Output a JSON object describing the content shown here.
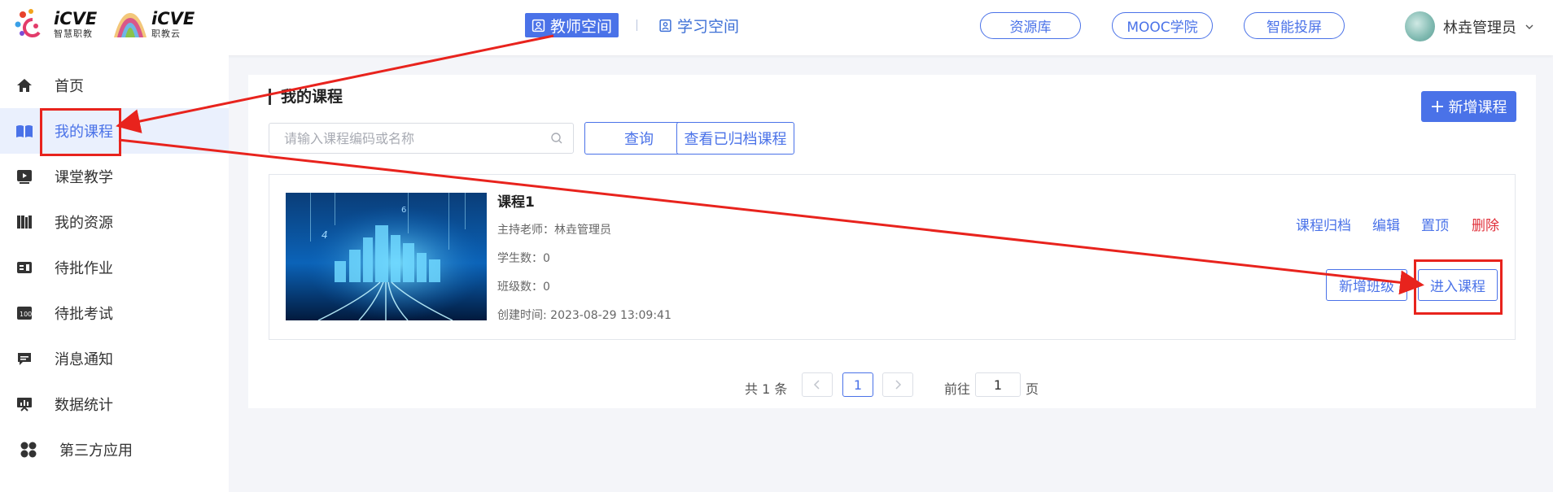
{
  "header": {
    "logos": [
      {
        "big": "iCVE",
        "small": "智慧职教"
      },
      {
        "big": "iCVE",
        "small": "职教云"
      }
    ],
    "space_tabs": [
      {
        "label": "教师空间",
        "icon": "portrait-icon",
        "active": true
      },
      {
        "label": "学习空间",
        "icon": "book-user-icon",
        "active": false
      }
    ],
    "buttons": [
      "资源库",
      "MOOC学院",
      "智能投屏"
    ],
    "user_name": "林垚管理员"
  },
  "sidebar": {
    "items": [
      {
        "label": "首页",
        "icon": "home-icon"
      },
      {
        "label": "我的课程",
        "icon": "open-book-icon",
        "active": true
      },
      {
        "label": "课堂教学",
        "icon": "play-screen-icon"
      },
      {
        "label": "我的资源",
        "icon": "books-shelf-icon"
      },
      {
        "label": "待批作业",
        "icon": "homework-icon"
      },
      {
        "label": "待批考试",
        "icon": "exam-icon"
      },
      {
        "label": "消息通知",
        "icon": "message-icon"
      },
      {
        "label": "数据统计",
        "icon": "statistics-icon"
      },
      {
        "label": "第三方应用",
        "icon": "apps-grid-icon"
      }
    ]
  },
  "main": {
    "title": "我的课程",
    "add_course_label": "新增课程",
    "search_placeholder": "请输入课程编码或名称",
    "query_label": "查询",
    "archived_label": "查看已归档课程",
    "course": {
      "title": "课程1",
      "teacher": "主持老师：林垚管理员",
      "students": "学生数：0",
      "classes": "班级数：0",
      "created": "创建时间: 2023-08-29 13:09:41",
      "actions": [
        "课程归档",
        "编辑",
        "置顶",
        "删除"
      ],
      "add_class_label": "新增班级",
      "enter_label": "进入课程"
    },
    "pagination": {
      "total": "共 1 条",
      "current": "1",
      "goto_prefix": "前往",
      "goto_value": "1",
      "goto_suffix": "页"
    }
  },
  "colors": {
    "accent": "#4a72e8",
    "danger": "#e0303a",
    "annotation": "#e8231d"
  }
}
